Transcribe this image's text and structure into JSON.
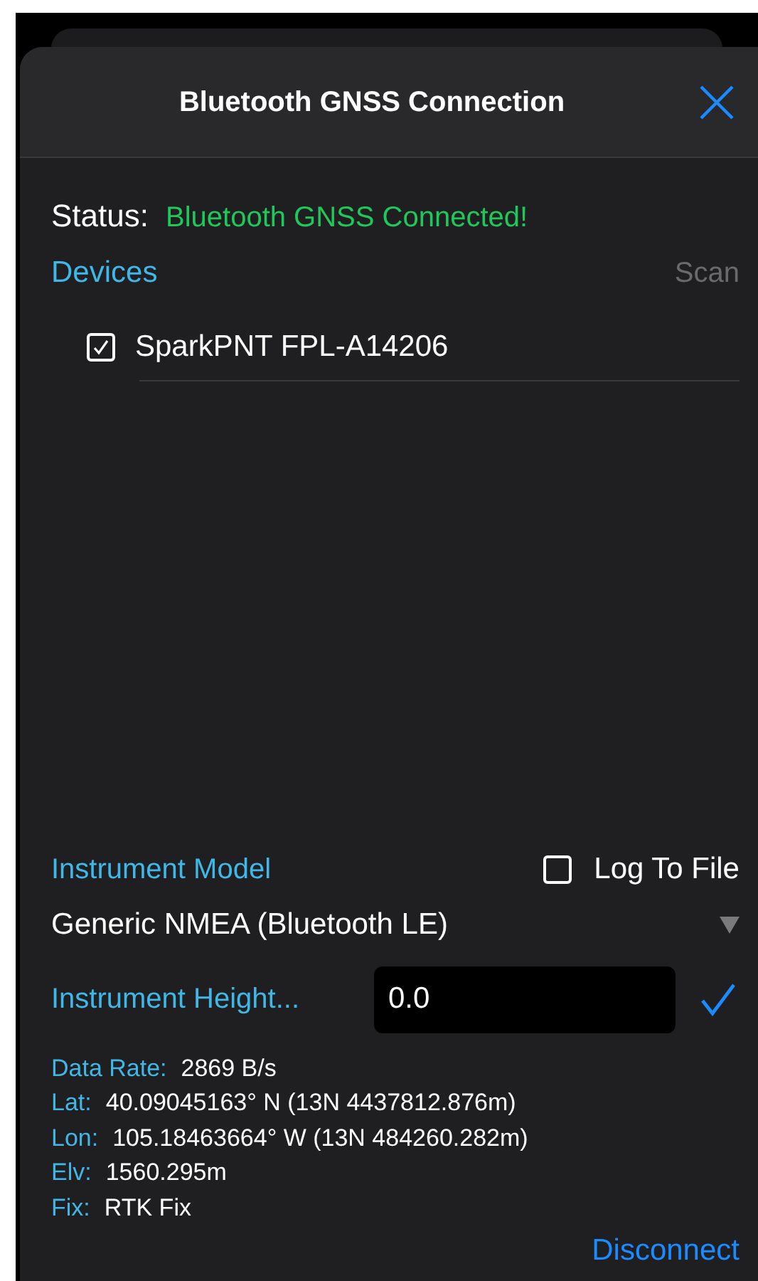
{
  "dialog": {
    "title": "Bluetooth GNSS Connection"
  },
  "status": {
    "label": "Status:",
    "value": "Bluetooth GNSS Connected!"
  },
  "devices": {
    "heading": "Devices",
    "scan": {
      "label": "Scan",
      "disabled": true
    },
    "items": [
      {
        "name": "SparkPNT FPL-A14206",
        "checked": true
      }
    ]
  },
  "instrument_model": {
    "label": "Instrument Model",
    "value": "Generic NMEA (Bluetooth LE)"
  },
  "log_to_file": {
    "label": "Log To File",
    "checked": false
  },
  "instrument_height": {
    "label": "Instrument Height...",
    "value": "0.0"
  },
  "readings": [
    {
      "label": "Data Rate:",
      "value": "2869 B/s"
    },
    {
      "label": "Lat:",
      "value": "40.09045163° N (13N 4437812.876m)"
    },
    {
      "label": "Lon:",
      "value": "105.18463664° W (13N 484260.282m)"
    },
    {
      "label": "Elv:",
      "value": "1560.295m"
    },
    {
      "label": "Fix:",
      "value": "RTK Fix"
    }
  ],
  "disconnect": "Disconnect"
}
